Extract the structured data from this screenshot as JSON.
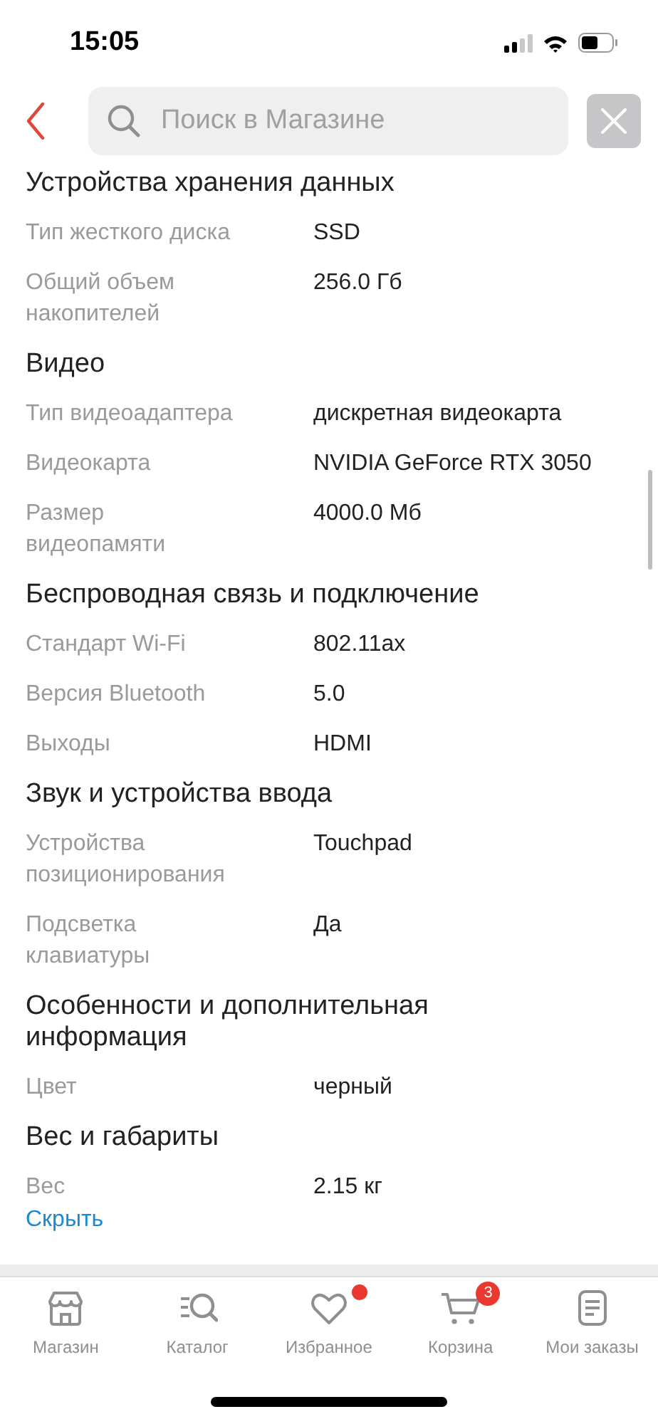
{
  "status_bar": {
    "time": "15:05"
  },
  "search": {
    "placeholder": "Поиск в Магазине"
  },
  "sections": [
    {
      "title": "Устройства хранения данных",
      "rows": [
        {
          "label": "Тип жесткого диска",
          "value": "SSD"
        },
        {
          "label": "Общий объем\nнакопителей",
          "value": "256.0 Гб"
        }
      ]
    },
    {
      "title": "Видео",
      "rows": [
        {
          "label": "Тип видеоадаптера",
          "value": "дискретная видеокарта"
        },
        {
          "label": "Видеокарта",
          "value": "NVIDIA GeForce RTX 3050"
        },
        {
          "label": "Размер\nвидеопамяти",
          "value": "4000.0 Мб"
        }
      ]
    },
    {
      "title": "Беспроводная связь и подключение",
      "rows": [
        {
          "label": "Стандарт Wi-Fi",
          "value": "802.11ax"
        },
        {
          "label": "Версия Bluetooth",
          "value": "5.0"
        },
        {
          "label": "Выходы",
          "value": "HDMI"
        }
      ]
    },
    {
      "title": "Звук и устройства ввода",
      "rows": [
        {
          "label": "Устройства\nпозиционирования",
          "value": "Touchpad"
        },
        {
          "label": "Подсветка\nклавиатуры",
          "value": "Да"
        }
      ]
    },
    {
      "title": "Особенности и дополнительная\nинформация",
      "rows": [
        {
          "label": "Цвет",
          "value": "черный"
        }
      ]
    },
    {
      "title": "Вес и габариты",
      "rows": [
        {
          "label": "Вес",
          "value": "2.15 кг"
        }
      ]
    }
  ],
  "hide_link": "Скрыть",
  "tabs": [
    {
      "kind": "store",
      "label": "Магазин"
    },
    {
      "kind": "catalog",
      "label": "Каталог"
    },
    {
      "kind": "favorites",
      "label": "Избранное",
      "badge": {
        "kind": "dot"
      }
    },
    {
      "kind": "cart",
      "label": "Корзина",
      "badge": {
        "kind": "count",
        "text": "3"
      }
    },
    {
      "kind": "orders",
      "label": "Мои заказы"
    }
  ]
}
